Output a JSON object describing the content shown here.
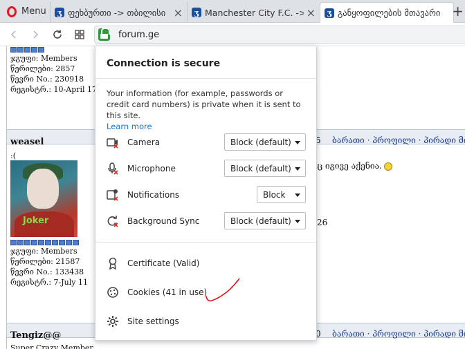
{
  "browser": {
    "menu_label": "Menu",
    "tabs": [
      {
        "title": "ფეხბურთი -> თბილისი",
        "active": false
      },
      {
        "title": "Manchester City F.C. -> თი",
        "active": false
      },
      {
        "title": "განყოფილების მთავარი",
        "active": true
      }
    ],
    "new_tab": "+",
    "url": "forum.ge"
  },
  "page": {
    "post1": {
      "group": "ჯგუფი: Members",
      "posts": "წერილები: 2857",
      "member_no": "წევრი No.: 230918",
      "registered": "რეგისტრ.: 10-April 17"
    },
    "post2": {
      "username": "weasel",
      "status": ":(",
      "avatar_text": "Joker",
      "group": "ჯგუფი: Members",
      "posts": "წერილები: 21587",
      "member_no": "წევრი No.: 133438",
      "registered": "რეგისტრ.: 7-July 11",
      "header_fragment": "5",
      "links": "ბარათი · პროფილი · პირადი მი",
      "text_fragment": "ც იგივე აქენია.",
      "small_fragment": "26"
    },
    "post3": {
      "username": "Tengiz@@",
      "status": "Super Crazy Member",
      "header_fragment": "0",
      "links": "ბარათი · პროფილი · პირადი მი"
    }
  },
  "popup": {
    "title": "Connection is secure",
    "description": "Your information (for example, passwords or credit card numbers) is private when it is sent to this site.",
    "learn_more": "Learn more",
    "permissions": [
      {
        "label": "Camera",
        "value": "Block (default)",
        "icon": "camera-blocked-icon"
      },
      {
        "label": "Microphone",
        "value": "Block (default)",
        "icon": "microphone-blocked-icon"
      },
      {
        "label": "Notifications",
        "value": "Block",
        "icon": "notifications-blocked-icon"
      },
      {
        "label": "Background Sync",
        "value": "Block (default)",
        "icon": "background-sync-blocked-icon"
      }
    ],
    "certificate": "Certificate (Valid)",
    "cookies": "Cookies (41 in use)",
    "site_settings": "Site settings"
  },
  "colors": {
    "secure_green": "#2e9a3c",
    "link_blue": "#1a6fd1",
    "block_red": "#d93025",
    "annotation_red": "#d61a1a"
  }
}
